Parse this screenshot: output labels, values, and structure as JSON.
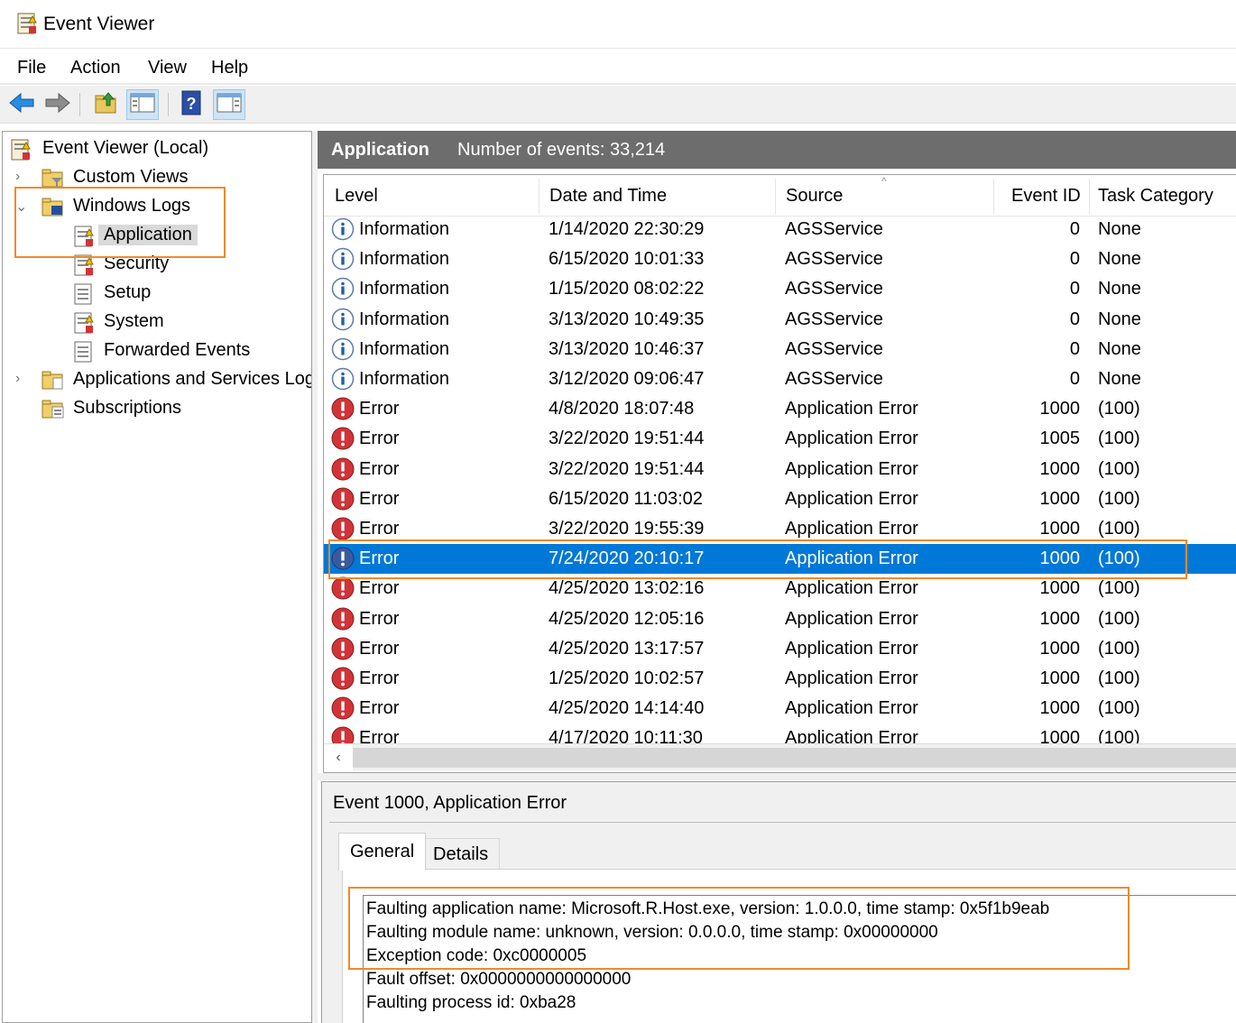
{
  "window": {
    "title": "Event Viewer"
  },
  "menu": [
    "File",
    "Action",
    "View",
    "Help"
  ],
  "toolbar": {
    "buttons": [
      "back-arrow-icon",
      "forward-arrow-icon",
      "up-folder-icon",
      "show-hide-tree-icon",
      "help-icon",
      "show-hide-action-pane-icon"
    ]
  },
  "tree": {
    "root": "Event Viewer (Local)",
    "custom_views": "Custom Views",
    "windows_logs": "Windows Logs",
    "application": "Application",
    "security": "Security",
    "setup": "Setup",
    "system": "System",
    "forwarded_events": "Forwarded Events",
    "apps_services": "Applications and Services Log",
    "subscriptions": "Subscriptions"
  },
  "log_header": {
    "name": "Application",
    "count": "Number of events: 33,214"
  },
  "columns": {
    "level": "Level",
    "date_time": "Date and Time",
    "source": "Source",
    "event_id": "Event ID",
    "task_category": "Task Category"
  },
  "events": [
    {
      "level": "Information",
      "date_time": "1/14/2020 22:30:29",
      "source": "AGSService",
      "event_id": "0",
      "task": "None"
    },
    {
      "level": "Information",
      "date_time": "6/15/2020 10:01:33",
      "source": "AGSService",
      "event_id": "0",
      "task": "None"
    },
    {
      "level": "Information",
      "date_time": "1/15/2020 08:02:22",
      "source": "AGSService",
      "event_id": "0",
      "task": "None"
    },
    {
      "level": "Information",
      "date_time": "3/13/2020 10:49:35",
      "source": "AGSService",
      "event_id": "0",
      "task": "None"
    },
    {
      "level": "Information",
      "date_time": "3/13/2020 10:46:37",
      "source": "AGSService",
      "event_id": "0",
      "task": "None"
    },
    {
      "level": "Information",
      "date_time": "3/12/2020 09:06:47",
      "source": "AGSService",
      "event_id": "0",
      "task": "None"
    },
    {
      "level": "Error",
      "date_time": "4/8/2020 18:07:48",
      "source": "Application Error",
      "event_id": "1000",
      "task": "(100)"
    },
    {
      "level": "Error",
      "date_time": "3/22/2020 19:51:44",
      "source": "Application Error",
      "event_id": "1005",
      "task": "(100)"
    },
    {
      "level": "Error",
      "date_time": "3/22/2020 19:51:44",
      "source": "Application Error",
      "event_id": "1000",
      "task": "(100)"
    },
    {
      "level": "Error",
      "date_time": "6/15/2020 11:03:02",
      "source": "Application Error",
      "event_id": "1000",
      "task": "(100)"
    },
    {
      "level": "Error",
      "date_time": "3/22/2020 19:55:39",
      "source": "Application Error",
      "event_id": "1000",
      "task": "(100)"
    },
    {
      "level": "Error",
      "date_time": "7/24/2020 20:10:17",
      "source": "Application Error",
      "event_id": "1000",
      "task": "(100)",
      "selected": true
    },
    {
      "level": "Error",
      "date_time": "4/25/2020 13:02:16",
      "source": "Application Error",
      "event_id": "1000",
      "task": "(100)"
    },
    {
      "level": "Error",
      "date_time": "4/25/2020 12:05:16",
      "source": "Application Error",
      "event_id": "1000",
      "task": "(100)"
    },
    {
      "level": "Error",
      "date_time": "4/25/2020 13:17:57",
      "source": "Application Error",
      "event_id": "1000",
      "task": "(100)"
    },
    {
      "level": "Error",
      "date_time": "1/25/2020 10:02:57",
      "source": "Application Error",
      "event_id": "1000",
      "task": "(100)"
    },
    {
      "level": "Error",
      "date_time": "4/25/2020 14:14:40",
      "source": "Application Error",
      "event_id": "1000",
      "task": "(100)"
    },
    {
      "level": "Error",
      "date_time": "4/17/2020 10:11:30",
      "source": "Application Error",
      "event_id": "1000",
      "task": "(100)"
    }
  ],
  "detail": {
    "title": "Event 1000, Application Error",
    "tabs": {
      "general": "General",
      "details": "Details"
    },
    "lines": [
      "Faulting application name: Microsoft.R.Host.exe, version: 1.0.0.0, time stamp: 0x5f1b9eab",
      "Faulting module name: unknown, version: 0.0.0.0, time stamp: 0x00000000",
      "Exception code: 0xc0000005",
      "Fault offset: 0x0000000000000000",
      "Faulting process id: 0xba28"
    ]
  },
  "colors": {
    "selection": "#0078d7",
    "header_band": "#6d6d6d",
    "highlight": "#f08a2a",
    "error_red": "#d13438",
    "info_blue": "#1f5fa8"
  }
}
